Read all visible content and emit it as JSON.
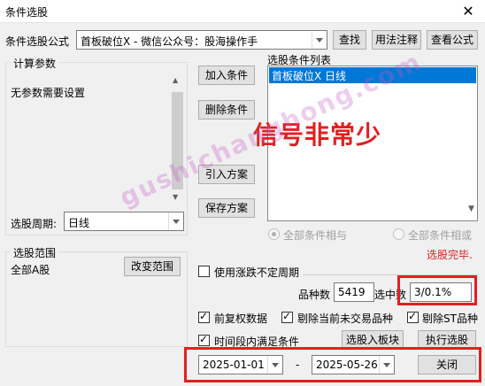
{
  "window": {
    "title": "条件选股"
  },
  "top": {
    "formula_label": "条件选股公式",
    "formula_value": "首板破位X  -  微信公众号：股海操作手",
    "find_btn": "查找",
    "usage_btn": "用法注释",
    "view_btn": "查看公式"
  },
  "params": {
    "group_title": "计算参数",
    "text": "无参数需要设置",
    "period_label": "选股周期:",
    "period_value": "日线"
  },
  "middle_buttons": {
    "add": "加入条件",
    "delete": "删除条件",
    "import": "引入方案",
    "save": "保存方案"
  },
  "conditions": {
    "title": "选股条件列表",
    "items": [
      "首板破位X  日线"
    ],
    "annotation": "信号非常少",
    "radio_and": "全部条件相与",
    "radio_or": "全部条件相或",
    "status": "选股完毕."
  },
  "range": {
    "group_title": "选股范围",
    "value": "全部A股",
    "change_btn": "改变范围"
  },
  "options": {
    "use_variable_period": "使用涨跌不定周期",
    "count_label": "品种数",
    "count_value": "5419",
    "selected_label": "选中数",
    "selected_value": "3/0.1%",
    "pre_adjust": "前复权数据",
    "exclude_untraded": "剔除当前未交易品种",
    "exclude_st": "剔除ST品种",
    "time_period": "时间段内满足条件",
    "to_sector_btn": "选股入板块",
    "run_btn": "执行选股"
  },
  "dates": {
    "start": "2025-01-01",
    "separator": "-",
    "end": "2025-05-26",
    "close_btn": "关闭"
  },
  "watermark": "gushichanghong.com",
  "colors": {
    "selection": "#0078d7",
    "annotation": "#e02020",
    "status": "#e02020"
  }
}
